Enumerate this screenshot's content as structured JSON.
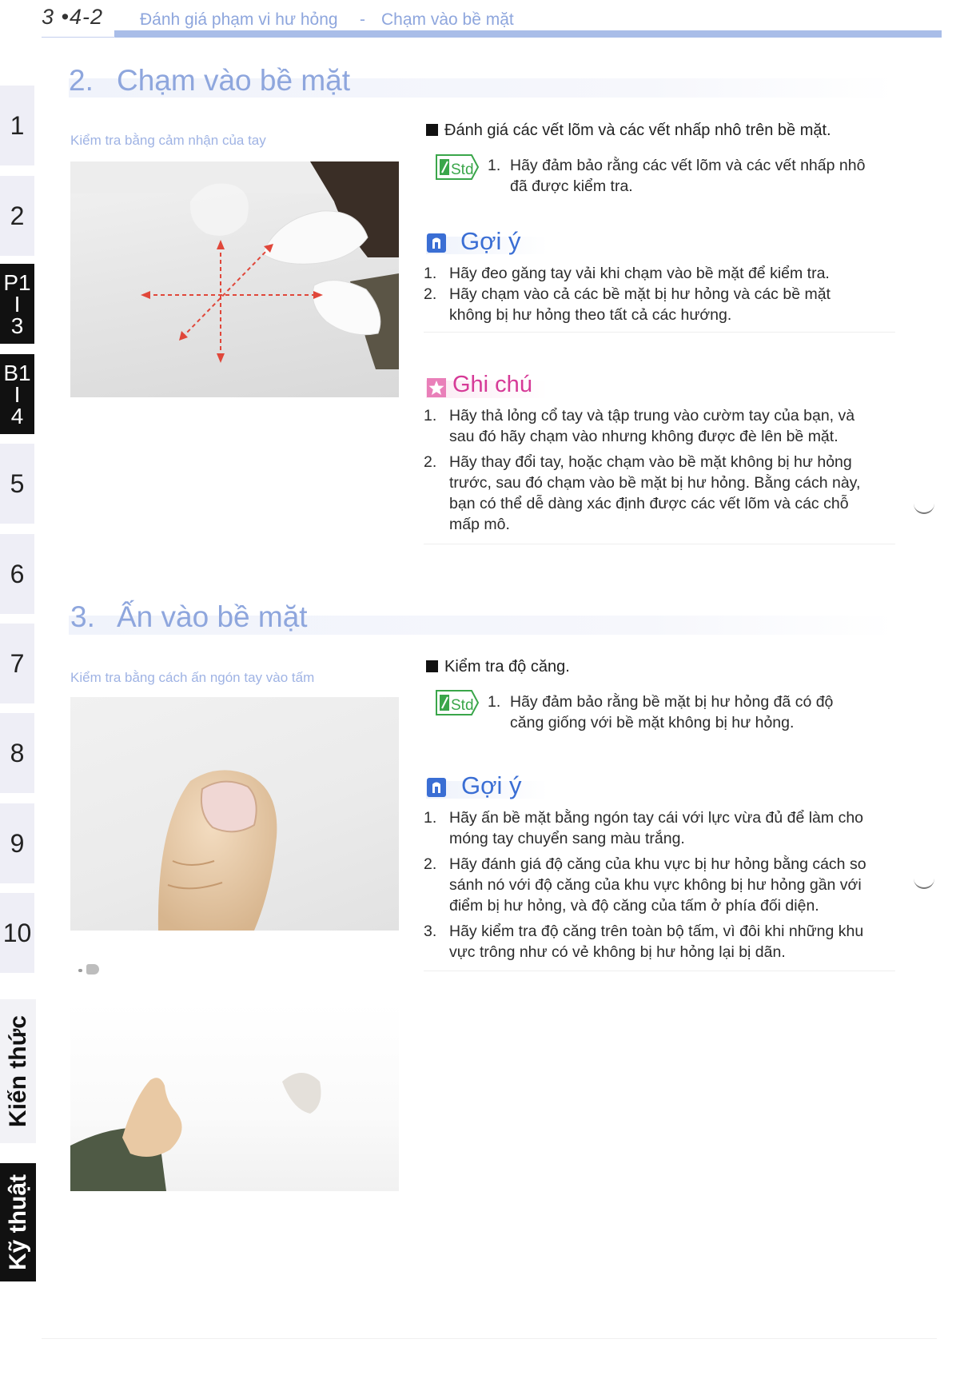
{
  "header": {
    "page_number": "3 •4-2",
    "chapter": "Đánh giá phạm vi hư hỏng",
    "separator": "-",
    "topic": "Chạm vào bề mặt"
  },
  "side_tabs": [
    {
      "label": "1"
    },
    {
      "label": "2"
    },
    {
      "lines": [
        "P1",
        "I",
        "3"
      ]
    },
    {
      "lines": [
        "B1",
        "I",
        "4"
      ]
    },
    {
      "label": "5"
    },
    {
      "label": "6"
    },
    {
      "label": "7"
    },
    {
      "label": "8"
    },
    {
      "label": "9"
    },
    {
      "label": "10"
    }
  ],
  "vertical_tabs": [
    "Kiến thức",
    "Kỹ thuật"
  ],
  "section2": {
    "number": "2.",
    "title": "Chạm vào bề mặt",
    "caption": "Kiểm tra bằng cảm nhận của tay",
    "bullet": "Đánh giá các vết lõm và các vết nhấp nhô trên bề mặt.",
    "std_label": "Std",
    "std_items": [
      {
        "n": "1.",
        "lines": [
          "Hãy đảm bảo rằng các vết lõm và các vết nhấp nhô",
          "đã được kiểm tra."
        ]
      }
    ],
    "tip_title": "Gợi ý",
    "tips": [
      {
        "n": "1.",
        "lines": [
          "Hãy đeo găng tay vải khi chạm vào bề mặt để kiểm tra."
        ]
      },
      {
        "n": "2.",
        "lines": [
          "Hãy chạm vào cả các bề mặt bị hư hỏng và các bề mặt",
          "không bị hư hỏng theo tất cả các hướng."
        ]
      }
    ],
    "note_title": "Ghi chú",
    "notes": [
      {
        "n": "1.",
        "lines": [
          "Hãy thả lỏng cổ tay và tập trung vào cườm tay của bạn, và",
          "sau đó hãy chạm vào nhưng không được đè lên bề mặt."
        ]
      },
      {
        "n": "2.",
        "lines": [
          "Hãy thay đổi tay, hoặc chạm vào bề mặt không bị hư hỏng",
          "trước, sau đó chạm vào bề mặt bị hư hỏng. Bằng cách này,",
          "bạn có thể dễ dàng xác định được các vết lõm và các chỗ",
          "mấp mô."
        ]
      }
    ]
  },
  "section3": {
    "number": "3.",
    "title": "Ấn vào bề mặt",
    "caption": "Kiểm tra bằng cách ấn ngón tay vào tấm",
    "bullet": "Kiểm tra độ căng.",
    "std_label": "Std",
    "std_items": [
      {
        "n": "1.",
        "lines": [
          "Hãy đảm bảo rằng bề mặt bị hư hỏng đã có độ",
          "căng giống với bề mặt không bị hư hỏng."
        ]
      }
    ],
    "tip_title": "Gợi ý",
    "tips": [
      {
        "n": "1.",
        "lines": [
          "Hãy ấn bề mặt bằng ngón tay cái với lực vừa đủ để làm cho",
          "móng tay chuyển sang màu trắng."
        ]
      },
      {
        "n": "2.",
        "lines": [
          "Hãy đánh giá độ căng của khu vực bị hư hỏng bằng cách so",
          "sánh nó với độ căng của khu vực không bị hư hỏng gần với",
          "điểm bị hư hỏng, và độ căng của tấm ở phía đối diện."
        ]
      },
      {
        "n": "3.",
        "lines": [
          "Hãy kiểm tra độ căng trên toàn bộ tấm, vì đôi khi những khu",
          "vực trông như có vẻ không bị hư hỏng lại bị dãn."
        ]
      }
    ]
  },
  "colors": {
    "header_blue": "#8ea6dd",
    "tip_blue": "#3a6ed4",
    "note_pink": "#d63a97",
    "std_green": "#3aa64a",
    "arrow_red": "#e0473a"
  }
}
